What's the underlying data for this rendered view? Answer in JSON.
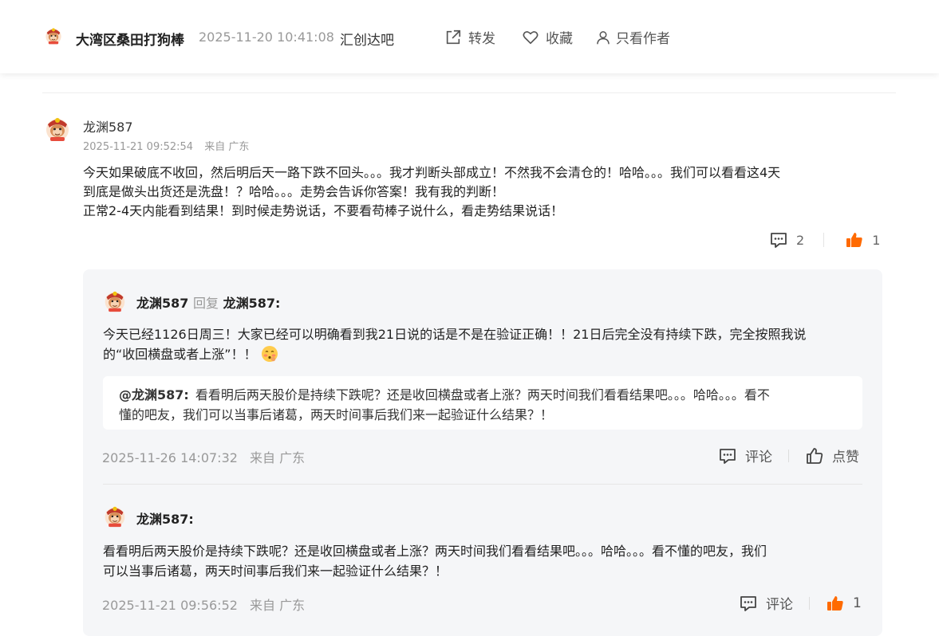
{
  "topbar": {
    "author": "大湾区桑田打狗棒",
    "time": "2025-11-20 10:41:08",
    "bar_name": "汇创达吧",
    "share_label": "转发",
    "favorite_label": "收藏",
    "author_only_label": "只看作者"
  },
  "comment": {
    "username": "龙渊587",
    "time": "2025-11-21 09:52:54",
    "location": "来自 广东",
    "text_line1": "今天如果破底不收回，然后明后天一路下跌不回头。。。我才判断头部成立！不然我不会清仓的！哈哈。。。我们可以看看这4天",
    "text_line2": "到底是做头出货还是洗盘！？哈哈。。。走势会告诉你答案！我有我的判断！",
    "text_line3": "正常2-4天内能看到结果！到时候走势说话，不要看苟棒子说什么，看走势结果说话！",
    "reply_count": "2",
    "like_count": "1"
  },
  "replies": [
    {
      "username": "龙渊587",
      "reply_word": "回复",
      "reply_to": "龙渊587:",
      "text_line1": "今天已经1126日周三！大家已经可以明确看到我21日说的话是不是在验证正确！！21日后完全没有持续下跌，完全按照我说",
      "text_line2": "的“收回横盘或者上涨”！！",
      "quote_user": "@龙渊587:",
      "quote_line1": "看看明后两天股价是持续下跌呢？还是收回横盘或者上涨？两天时间我们看看结果吧。。。哈哈。。。看不",
      "quote_line2": "懂的吧友，我们可以当事后诸葛，两天时间事后我们来一起验证什么结果？！",
      "time": "2025-11-26 14:07:32",
      "location": "来自 广东",
      "comment_label": "评论",
      "like_label": "点赞"
    },
    {
      "username": "龙渊587:",
      "text_line1": "看看明后两天股价是持续下跌呢？还是收回横盘或者上涨？两天时间我们看看结果吧。。。哈哈。。。看不懂的吧友，我们",
      "text_line2": "可以当事后诸葛，两天时间事后我们来一起验证什么结果？！",
      "time": "2025-11-21 09:56:52",
      "location": "来自 广东",
      "comment_label": "评论",
      "like_count": "1"
    }
  ],
  "colors": {
    "like_active": "#ff6a00",
    "meta_gray": "#999999",
    "reply_bg": "#f5f6f8"
  },
  "icons": [
    "avatar-monkey-icon",
    "share-icon",
    "heart-icon",
    "person-icon",
    "comment-icon",
    "thumbs-up-icon",
    "blush-emoji-icon"
  ]
}
